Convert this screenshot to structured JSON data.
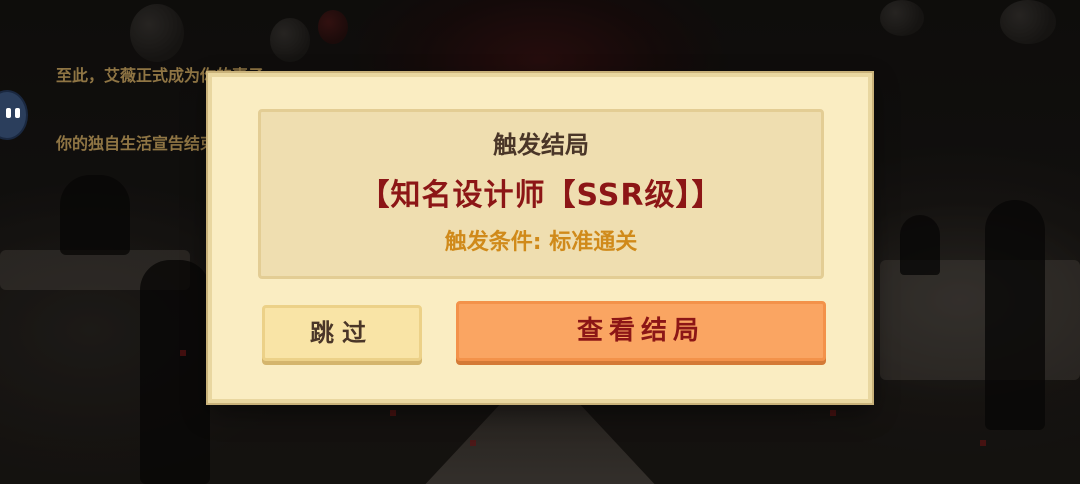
{
  "story": {
    "line1": "至此，艾薇正式成为你的妻子",
    "line2": "你的独自生活宣告结束"
  },
  "side_button": {
    "icon": "chat-bot-icon"
  },
  "dialog": {
    "title": "触发结局",
    "ending_name": "【知名设计师【SSR级】】",
    "condition": "触发条件: 标准通关",
    "skip_label": "跳过",
    "view_label": "查看结局"
  },
  "colors": {
    "panel_bg": "#faedc2",
    "inner_bg": "#efdeb0",
    "ending_red": "#8c1616",
    "condition_orange": "#d08a1a",
    "primary_button": "#faa562",
    "secondary_button": "#f9e4a6"
  }
}
